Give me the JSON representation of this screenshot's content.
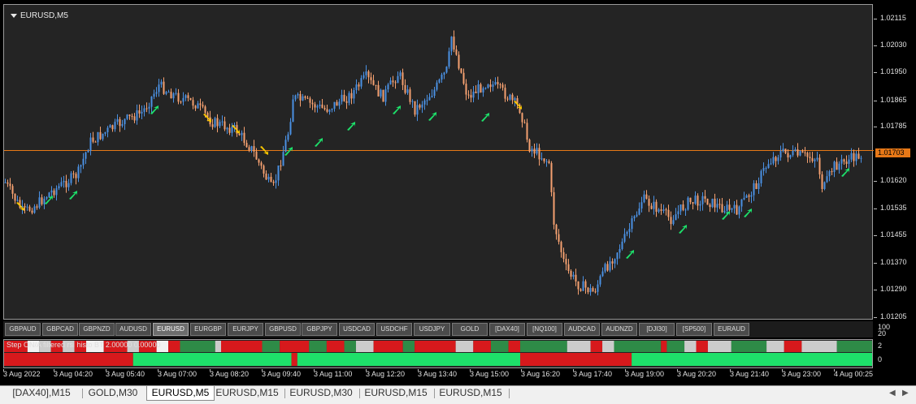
{
  "chart": {
    "symbol": "EURUSD,M5",
    "current_price": "1.01703",
    "price_labels": [
      "1.02115",
      "1.02030",
      "1.01950",
      "1.01865",
      "1.01785",
      "1.01703",
      "1.01620",
      "1.01535",
      "1.01455",
      "1.01370",
      "1.01290",
      "1.01205"
    ],
    "colors": {
      "bull": "#4a90e2",
      "bear": "#f4a070",
      "price_line": "#e77817",
      "up_arrow": "#1de06a",
      "down_arrow": "#f5c400"
    }
  },
  "symbol_buttons": [
    "GBPAUD",
    "GBPCAD",
    "GBPNZD",
    "AUDUSD",
    "EURUSD",
    "EURGBP",
    "EURJPY",
    "GBPUSD",
    "GBPJPY",
    "USDCAD",
    "USDCHF",
    "USDJPY",
    "GOLD",
    "[DAX40]",
    "[NQ100]",
    "AUDCAD",
    "AUDNZD",
    "[DJI30]",
    "[SP500]",
    "EURAUD"
  ],
  "active_symbol": "EURUSD",
  "indicator": {
    "label": "Step ON/A filtered rsi histo BT 2.00000 0.00000",
    "labels": {
      "top_hundred": "100",
      "top_twenty": "20",
      "two": "2",
      "zero": "0"
    },
    "colors": {
      "red": "#d7191c",
      "green": "#1ee06a",
      "dkgreen": "#2e8b47",
      "grey": "#cccccc",
      "white": "#f2f2f2"
    }
  },
  "time_labels": [
    "3 Aug 2022",
    "3 Aug 04:20",
    "3 Aug 05:40",
    "3 Aug 07:00",
    "3 Aug 08:20",
    "3 Aug 09:40",
    "3 Aug 11:00",
    "3 Aug 12:20",
    "3 Aug 13:40",
    "3 Aug 15:00",
    "3 Aug 16:20",
    "3 Aug 17:40",
    "3 Aug 19:00",
    "3 Aug 20:20",
    "3 Aug 21:40",
    "3 Aug 23:00",
    "4 Aug 00:25"
  ],
  "tabs": [
    "[DAX40],M15",
    "GOLD,M30",
    "EURUSD,M5",
    "EURUSD,M15",
    "EURUSD,M30",
    "EURUSD,M15",
    "EURUSD,M15"
  ],
  "active_tab_index": 2,
  "tab_nav": {
    "left_arrow": "◀",
    "right_arrow": "▶"
  }
}
